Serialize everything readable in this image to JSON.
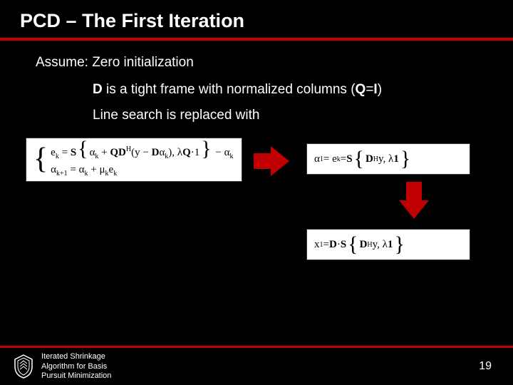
{
  "title": "PCD – The First Iteration",
  "assume_label": "Assume:",
  "bullets": {
    "b1": "Zero initialization",
    "b2_pre": "D",
    "b2_mid": " is a tight frame with normalized columns (",
    "b2_q": "Q",
    "b2_eq": "=",
    "b2_i": "I",
    "b2_post": ")",
    "b3": "Line search is replaced with"
  },
  "eq_left": {
    "r1_a": "e",
    "r1_b": "k",
    "r1_c": " = ",
    "r1_d": "S",
    "r1_e": "α",
    "r1_f": "k",
    "r1_g": " + ",
    "r1_h": "QD",
    "r1_i": "H",
    "r1_j": "(y − ",
    "r1_k": "D",
    "r1_l": "α",
    "r1_m": "k",
    "r1_n": "), λ",
    "r1_o": "Q",
    "r1_p": "·1",
    "r1_q": " − α",
    "r1_r": "k",
    "r2_a": "α",
    "r2_b": "k+1",
    "r2_c": " = α",
    "r2_d": "k",
    "r2_e": " + μ",
    "r2_f": "k",
    "r2_g": "e",
    "r2_h": "k"
  },
  "eq_rt": {
    "a": "α",
    "b": "1",
    "c": " = e",
    "d": "k",
    "e": " = ",
    "f": "S",
    "g": " D",
    "h": "H",
    "i": "y, λ",
    "j": "1"
  },
  "eq_rb": {
    "a": "x",
    "b": "1",
    "c": " = ",
    "d": "D",
    "e": "·",
    "f": "S",
    "g": " D",
    "h": "H",
    "i": "y, λ",
    "j": "1"
  },
  "footer": {
    "line1": "Iterated Shrinkage",
    "line2": "Algorithm for Basis",
    "line3": "Pursuit Minimization"
  },
  "page": "19"
}
